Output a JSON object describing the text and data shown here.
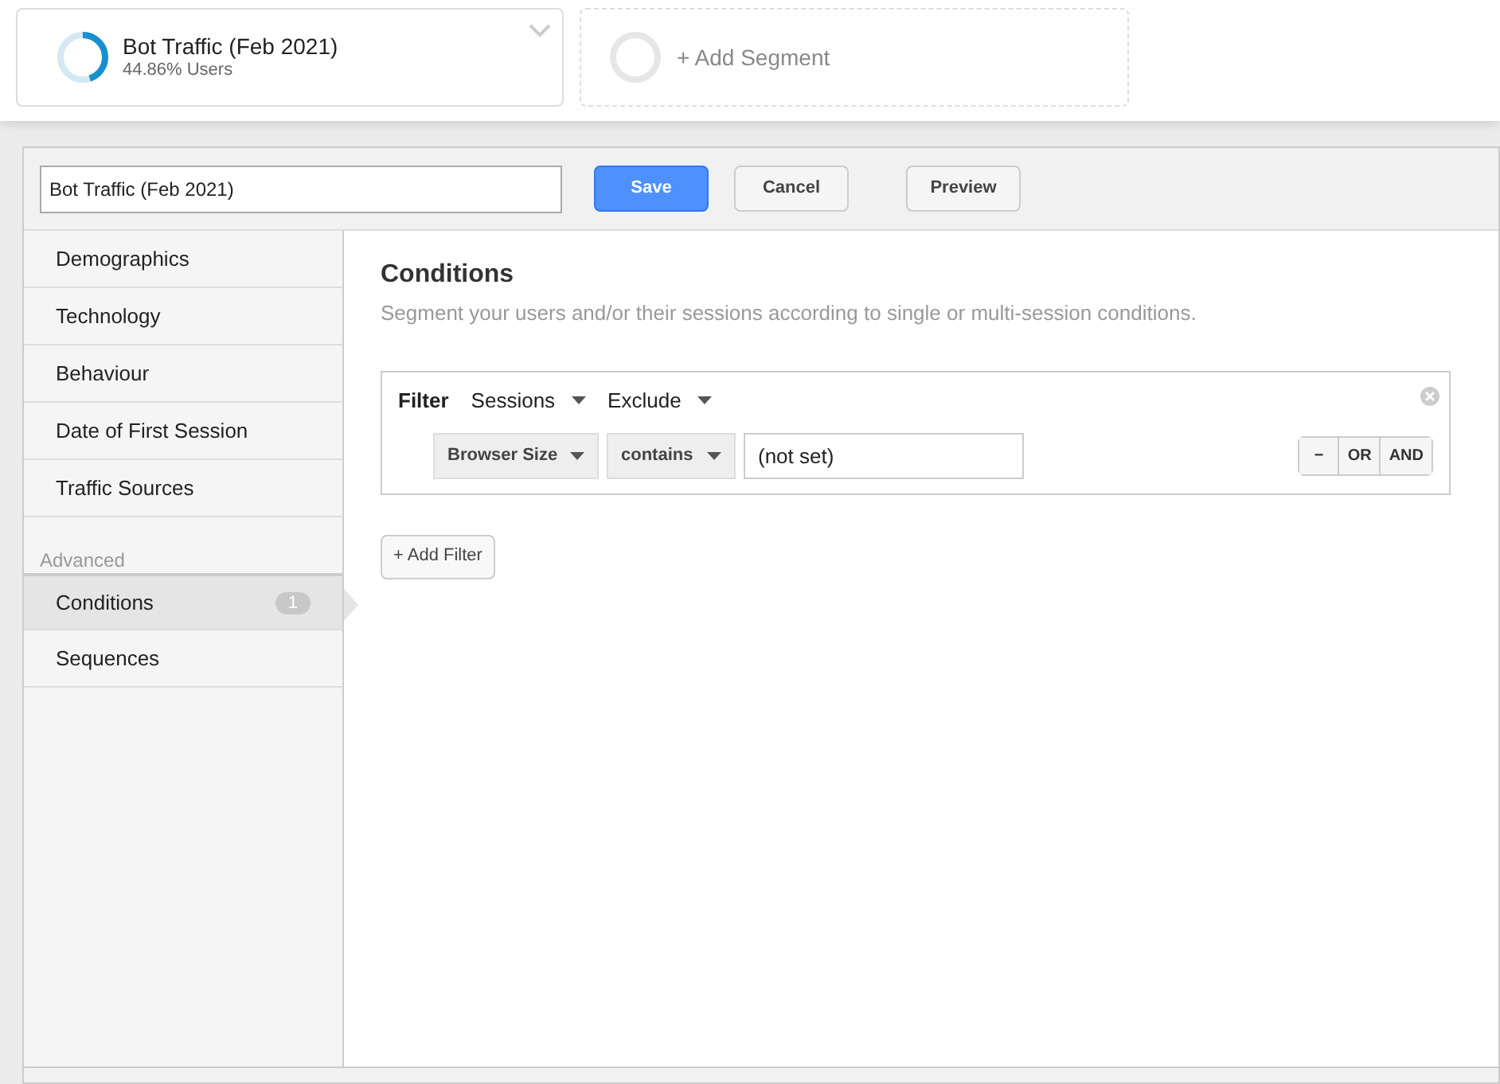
{
  "segments": [
    {
      "kind": "active",
      "title": "Bot Traffic (Feb 2021)",
      "subtitle": "44.86% Users",
      "level": 0.4486
    },
    {
      "kind": "add",
      "title": "+ Add Segment"
    }
  ],
  "editor": {
    "name_field": {
      "value": "Bot Traffic (Feb 2021)"
    },
    "buttons": [
      {
        "label": "Save",
        "kind": "primary"
      },
      {
        "label": "Cancel",
        "kind": "plain"
      },
      {
        "label": "Preview",
        "kind": "plain"
      }
    ]
  },
  "sidebar": {
    "items": [
      {
        "label": "Demographics",
        "selected": false
      },
      {
        "label": "Technology",
        "selected": false
      },
      {
        "label": "Behaviour",
        "selected": false
      },
      {
        "label": "Date of First Session",
        "selected": false
      },
      {
        "label": "Traffic Sources",
        "selected": false
      }
    ],
    "advanced_heading": "Advanced",
    "advanced_items": [
      {
        "label": "Conditions",
        "selected": true,
        "count": "1"
      },
      {
        "label": "Sequences",
        "selected": false
      }
    ]
  },
  "conditions": {
    "title": "Conditions",
    "description": "Segment your users and/or their sessions according to single or multi-session conditions.",
    "filter": {
      "label": "Filter",
      "scope": "Sessions",
      "mode": "Exclude",
      "dimension": "Browser Size",
      "operator": "contains",
      "value": "(not set)",
      "logic_buttons": [
        "−",
        "OR",
        "AND"
      ]
    },
    "add_filter": "+ Add Filter"
  }
}
